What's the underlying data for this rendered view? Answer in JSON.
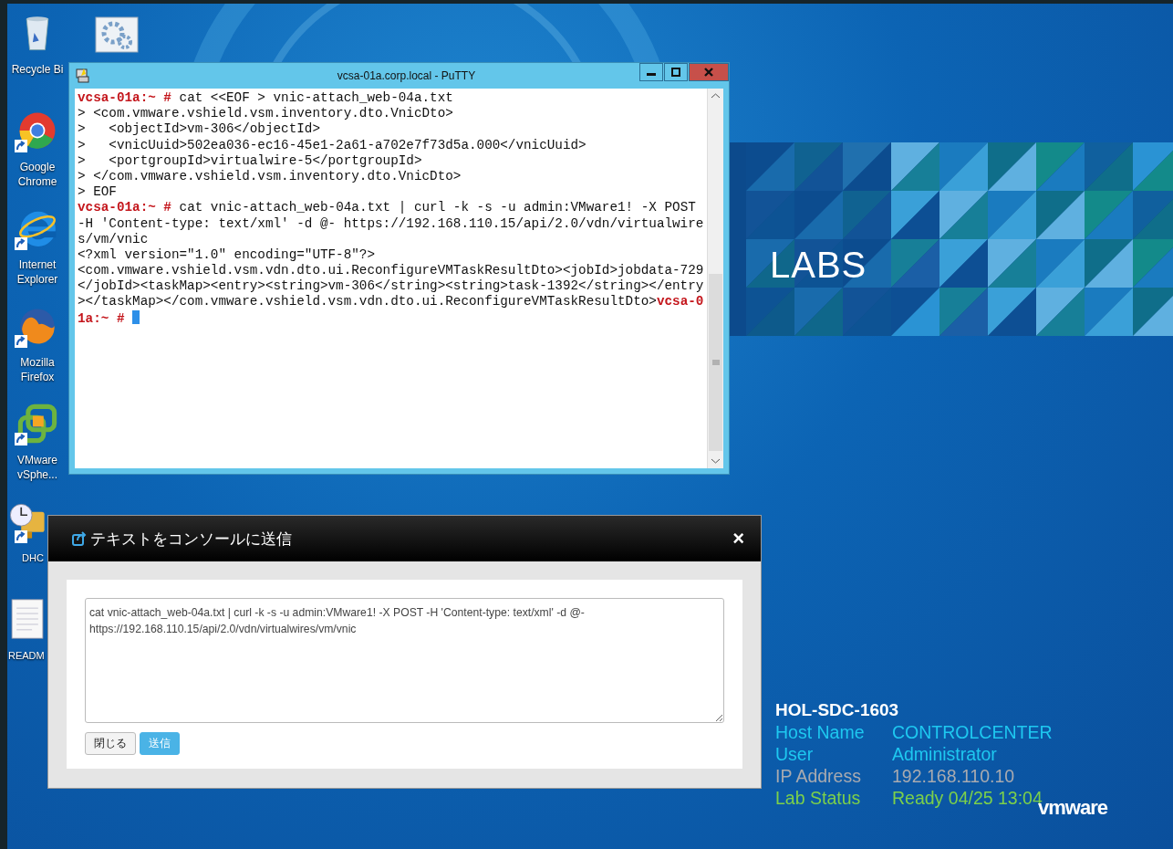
{
  "desktop_icons": [
    {
      "kind": "recycle-bin",
      "label": "Recycle Bi",
      "shortcut": false
    },
    {
      "kind": "chrome",
      "label": "Google Chrome",
      "shortcut": true
    },
    {
      "kind": "ie",
      "label": "Internet Explorer",
      "shortcut": true
    },
    {
      "kind": "firefox",
      "label": "Mozilla Firefox",
      "shortcut": true
    },
    {
      "kind": "vsphere",
      "label": "VMware vSphe...",
      "shortcut": true
    },
    {
      "kind": "dhcp",
      "label": "DHC",
      "shortcut": true
    },
    {
      "kind": "readme",
      "label": "READM",
      "shortcut": false
    }
  ],
  "wallpaper": {
    "brand_text": "LABS",
    "logo": "vmware"
  },
  "putty": {
    "title": "vcsa-01a.corp.local - PuTTY",
    "lines": [
      [
        {
          "kind": "prompt",
          "text": "vcsa-01a:~ #"
        },
        {
          "kind": "text",
          "text": " cat <<EOF > vnic-attach_web-04a.txt"
        }
      ],
      [
        {
          "kind": "text",
          "text": "> <com.vmware.vshield.vsm.inventory.dto.VnicDto>"
        }
      ],
      [
        {
          "kind": "text",
          "text": ">   <objectId>vm-306</objectId>"
        }
      ],
      [
        {
          "kind": "text",
          "text": ">   <vnicUuid>502ea036-ec16-45e1-2a61-a702e7f73d5a.000</vnicUuid>"
        }
      ],
      [
        {
          "kind": "text",
          "text": ">   <portgroupId>virtualwire-5</portgroupId>"
        }
      ],
      [
        {
          "kind": "text",
          "text": "> </com.vmware.vshield.vsm.inventory.dto.VnicDto>"
        }
      ],
      [
        {
          "kind": "text",
          "text": "> EOF"
        }
      ],
      [
        {
          "kind": "prompt",
          "text": "vcsa-01a:~ #"
        },
        {
          "kind": "text",
          "text": " cat vnic-attach_web-04a.txt | curl -k -s -u admin:VMware1! -X POST"
        }
      ],
      [
        {
          "kind": "text",
          "text": "-H 'Content-type: text/xml' -d @- https://192.168.110.15/api/2.0/vdn/virtualwire"
        }
      ],
      [
        {
          "kind": "text",
          "text": "s/vm/vnic"
        }
      ],
      [
        {
          "kind": "text",
          "text": "<?xml version=\"1.0\" encoding=\"UTF-8\"?>"
        }
      ],
      [
        {
          "kind": "text",
          "text": "<com.vmware.vshield.vsm.vdn.dto.ui.ReconfigureVMTaskResultDto><jobId>jobdata-729"
        }
      ],
      [
        {
          "kind": "text",
          "text": "</jobId><taskMap><entry><string>vm-306</string><string>task-1392</string></entry"
        }
      ],
      [
        {
          "kind": "text",
          "text": "></taskMap></com.vmware.vshield.vsm.vdn.dto.ui.ReconfigureVMTaskResultDto>"
        },
        {
          "kind": "prompt",
          "text": "vcsa-0"
        }
      ],
      [
        {
          "kind": "prompt",
          "text": "1a:~ #"
        },
        {
          "kind": "cursor"
        }
      ]
    ]
  },
  "send_dialog": {
    "title": "テキストをコンソールに送信",
    "close": "×",
    "value": "cat vnic-attach_web-04a.txt | curl -k -s -u admin:VMware1! -X POST -H 'Content-type: text/xml' -d @- https://192.168.110.15/api/2.0/vdn/virtualwires/vm/vnic",
    "buttons": [
      {
        "label": "閉じる",
        "primary": false
      },
      {
        "label": "送信",
        "primary": true
      }
    ]
  },
  "lab_info": {
    "title": "HOL-SDC-1603",
    "rows": [
      {
        "label": "Host Name",
        "value": "CONTROLCENTER",
        "color": "#1ec8f0"
      },
      {
        "label": "User",
        "value": "Administrator",
        "color": "#1ec8f0"
      },
      {
        "label": "IP Address",
        "value": "192.168.110.10",
        "color": "#a8aab0"
      },
      {
        "label": "Lab Status",
        "value": "Ready 04/25 13:04",
        "color": "#7cd04a"
      }
    ]
  }
}
